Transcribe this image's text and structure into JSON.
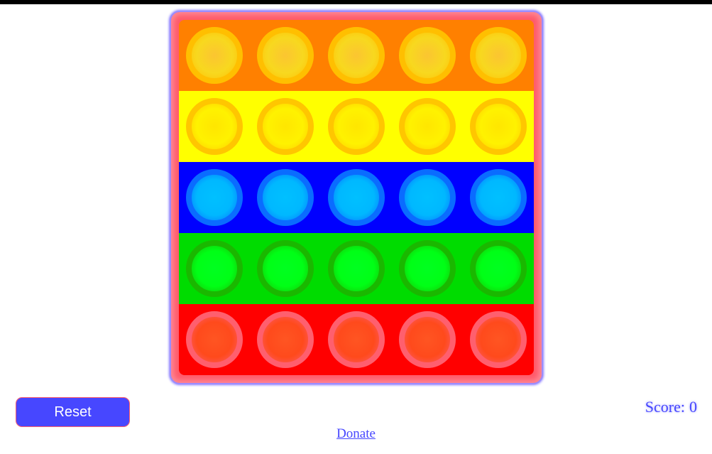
{
  "game": {
    "columns": 5,
    "rows": [
      {
        "color": "orange",
        "background": "#ff8000",
        "bubble_fill": "#f8d81f",
        "bubble_ring": "#ffbf00",
        "bubble_center": "#fbc531"
      },
      {
        "color": "yellow",
        "background": "#ffff00",
        "bubble_fill": "#fff200",
        "bubble_ring": "#ffc600",
        "bubble_center": "#ffe600"
      },
      {
        "color": "blue",
        "background": "#0000ff",
        "bubble_fill": "#00b8ff",
        "bubble_ring": "#0a6cff",
        "bubble_center": "#00c0ff"
      },
      {
        "color": "green",
        "background": "#00dc00",
        "bubble_fill": "#00ff16",
        "bubble_ring": "#1ab800",
        "bubble_center": "#00ff20"
      },
      {
        "color": "red",
        "background": "#ff0000",
        "bubble_fill": "#ff4a1c",
        "bubble_ring": "#ff5f6e",
        "bubble_center": "#ff5522"
      }
    ],
    "board_color": "#ff5a6a"
  },
  "controls": {
    "reset_label": "Reset",
    "reset_color": "#4747ff"
  },
  "score": {
    "label": "Score:",
    "value": "0"
  },
  "footer": {
    "donate_label": "Donate"
  }
}
